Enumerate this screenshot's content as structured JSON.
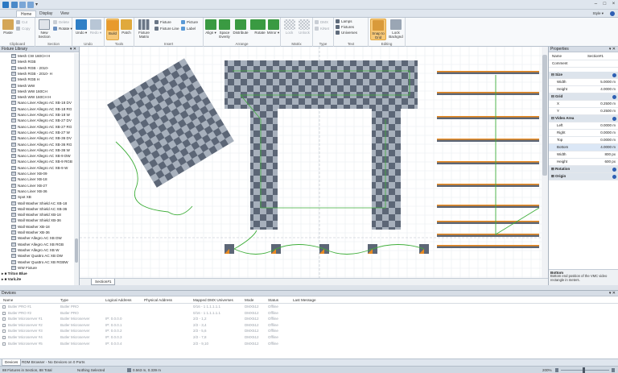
{
  "title": {
    "app_name": "",
    "style_label": "Style"
  },
  "tabs": [
    "Home",
    "Display",
    "View"
  ],
  "ribbon": {
    "clipboard": {
      "label": "Clipboard",
      "paste": "Paste",
      "cut": "Cut",
      "copy": "Copy"
    },
    "section": {
      "label": "Section",
      "new_section": "New Section",
      "delete": "Delete",
      "rotate": "Rotate"
    },
    "undo": {
      "label": "Undo",
      "undo": "Undo",
      "redo": "Redo"
    },
    "tools": {
      "label": "Tools",
      "build": "Build",
      "patch": "Patch"
    },
    "insert": {
      "label": "Insert",
      "fixture_matrix": "Fixture Matrix",
      "fixture": "Fixture",
      "fixture_line": "Fixture Line",
      "picture": "Picture",
      "label_btn": "Label"
    },
    "arrange": {
      "label": "Arrange",
      "align": "Align",
      "space_evenly": "Space Evenly",
      "distribute": "Distribute",
      "zoom": "Zoom",
      "rotate": "Rotate",
      "mirror": "Mirror"
    },
    "matrix": {
      "label": "Matrix",
      "lock": "Lock",
      "unlock": "Unlock"
    },
    "type": {
      "label": "Type",
      "dmx": "DMX",
      "kinet": "KiNet"
    },
    "text": {
      "label": "Text",
      "lamps": "Lamps",
      "fixtures": "Fixtures",
      "universes": "Universes"
    },
    "editing": {
      "label": "Editing",
      "snap": "Snap to Grid",
      "lock_bg": "Lock Backgnd"
    }
  },
  "library": {
    "title": "Fixture Library",
    "items": [
      "Mesh CW 160CH H",
      "Mesh RGB",
      "Mesh RGB - 2010-",
      "Mesh RGB - 2010- H",
      "Mesh RGB H",
      "Mesh WW",
      "Mesh WW 160CH",
      "Mesh WW 160CH H",
      "Nano Liner Allegro AC XB-18 DV",
      "Nano Liner Allegro AC XB-18 RG",
      "Nano Liner Allegro AC XB-18 W",
      "Nano Liner Allegro AC XB-27 DV",
      "Nano Liner Allegro AC XB-27 RG",
      "Nano Liner Allegro AC XB-27 W",
      "Nano Liner Allegro AC XB-36 DV",
      "Nano Liner Allegro AC XB-36 RG",
      "Nano Liner Allegro AC XB-36 W",
      "Nano Liner Allegro AC XB-9 DW",
      "Nano Liner Allegro AC XB-9 RGB",
      "Nano Liner Allegro AC XB-9 W",
      "Nano Liner XB-09",
      "Nano Liner XB-18",
      "Nano Liner XB-27",
      "Nano Liner XB-36",
      "Spot XB",
      "Wall Washer Shield AC XB-18",
      "Wall Washer Shield AC XB-36",
      "Wall Washer Shield XB-18",
      "Wall Washer Shield XB-36",
      "Wall Washer XB-18",
      "Wall Washer XB-36",
      "Washer Allegro AC XB DW",
      "Washer Allegro AC XB RGB",
      "Washer Allegro AC XB W",
      "Washer Quattro AC XB DW",
      "Washer Quattro AC XB RGBW",
      "WW Fixture"
    ],
    "groups": [
      "Triton Blue",
      "VariLite"
    ]
  },
  "canvas": {
    "section_tab": "Section#1"
  },
  "properties": {
    "title": "Properties",
    "name_key": "Name",
    "name_val": "Section#1",
    "comment_key": "Comment",
    "size_cat": "Size",
    "width_key": "Width",
    "width_val": "5.0000 m",
    "height_key": "Height",
    "height_val": "4.0000 m",
    "grid_cat": "Grid",
    "x_key": "X",
    "x_val": "0.2500 m",
    "y_key": "Y",
    "y_val": "0.2500 m",
    "video_cat": "Video Area",
    "left_key": "Left",
    "left_val": "0.0000 m",
    "right_key": "Right",
    "right_val": "0.0000 m",
    "top_key": "Top",
    "top_val": "0.0000 m",
    "bottom_key": "Bottom",
    "bottom_val": "4.0000 m",
    "vw_key": "Width",
    "vw_val": "800 px",
    "vh_key": "Height",
    "vh_val": "600 px",
    "rotation_cat": "Rotation",
    "origin_cat": "Origin",
    "help_title": "Bottom",
    "help_text": "Bottom end position of the VMC video rectangle in meters."
  },
  "devices": {
    "title": "Devices",
    "columns": [
      "Name",
      "Type",
      "Logical Address",
      "Physical Address",
      "Mapped DMX Universes",
      "Mode",
      "Status",
      "Last Message"
    ],
    "rows": [
      [
        "Butler PRO #1",
        "Butler PRO",
        "",
        "",
        "0/16 - 1 1.1.1.1.1",
        "DMX512",
        "Offline",
        ""
      ],
      [
        "Butler PRO #2",
        "Butler PRO",
        "",
        "",
        "0/16 - 1 1.1.1.1.1",
        "DMX512",
        "Offline",
        ""
      ],
      [
        "Butler Microserver #1",
        "Butler Microserver",
        "IP: 0.0.0.0",
        "",
        "2/2 - 1,2",
        "DMX512",
        "Offline",
        ""
      ],
      [
        "Butler Microserver #2",
        "Butler Microserver",
        "IP: 0.0.0.1",
        "",
        "2/2 - 3,4",
        "DMX512",
        "Offline",
        ""
      ],
      [
        "Butler Microserver #3",
        "Butler Microserver",
        "IP: 0.0.0.2",
        "",
        "2/2 - 5,6",
        "DMX512",
        "Offline",
        ""
      ],
      [
        "Butler Microserver #4",
        "Butler Microserver",
        "IP: 0.0.0.3",
        "",
        "2/2 - 7,8",
        "DMX512",
        "Offline",
        ""
      ],
      [
        "Butler Microserver #5",
        "Butler Microserver",
        "IP: 0.0.0.4",
        "",
        "2/2 - 9,10",
        "DMX512",
        "Offline",
        ""
      ]
    ]
  },
  "bottom_tabs": [
    "Devices",
    "RDM Browser - No Devices on 0 Ports"
  ],
  "status": {
    "fixtures": "88 Fixtures in Section, 88 Total",
    "selection": "Nothing Selected",
    "coords": "0.563 m, 0.339 m",
    "zoom": "200%"
  },
  "colors": {
    "accent": "#2e5fb3",
    "ribbon_highlight": "#f6c878",
    "grid": "#e8ecf0",
    "fixture_dark": "#5c6676",
    "fixture_light": "#a7b0bc",
    "patch_line": "#3fae3a",
    "bar_orange": "#e88a22"
  }
}
